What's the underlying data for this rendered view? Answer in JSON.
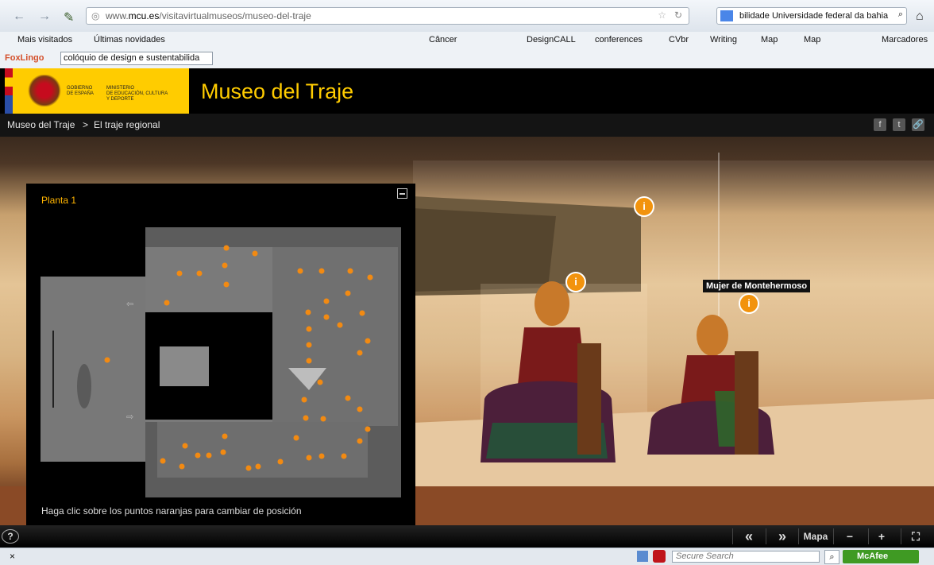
{
  "browser": {
    "url_prefix": "www.",
    "url_domain": "mcu.es",
    "url_path": "/visitavirtualmuseos/museo-del-traje",
    "search_text": "bilidade Universidade federal da bahia"
  },
  "bookmarks": [
    {
      "label": "Mais visitados"
    },
    {
      "label": "Últimas novidades"
    },
    {
      "label": "Câncer"
    },
    {
      "label": "DesignCALL"
    },
    {
      "label": "conferences"
    },
    {
      "label": "CVbr"
    },
    {
      "label": "Writing"
    },
    {
      "label": "Map"
    },
    {
      "label": "Map"
    }
  ],
  "bookmarks_menu": "Marcadores",
  "foxlingo": {
    "brand": "FoxLingo",
    "selected": "colóquio de design e sustentabilida"
  },
  "site": {
    "gov_line1": "GOBIERNO",
    "gov_line2": "DE ESPAÑA",
    "ministry_line1": "MINISTERIO",
    "ministry_line2": "DE EDUCACIÓN, CULTURA",
    "ministry_line3": "Y DEPORTE",
    "title": "Museo del Traje"
  },
  "breadcrumb": {
    "root": "Museo del Traje",
    "sep": ">",
    "current": "El traje regional"
  },
  "social": {
    "facebook": "f",
    "twitter": "t",
    "link": "🔗"
  },
  "hotspots": [
    {
      "symbol": "i"
    },
    {
      "symbol": "i"
    },
    {
      "symbol": "i",
      "label": "Mujer de Montehermoso"
    }
  ],
  "map": {
    "floor_name": "Planta 1",
    "hint": "Haga clic sobre los puntos naranjas para cambiar de posición",
    "point_color": "#f28a12"
  },
  "toolbar": {
    "help": "?",
    "prev": "«",
    "next": "»",
    "map": "Mapa",
    "zoom_out": "−",
    "zoom_in": "+",
    "fullscreen": "⛶"
  },
  "statusbar": {
    "close": "×",
    "search_placeholder": "Secure Search",
    "mcafee": "McAfee"
  }
}
